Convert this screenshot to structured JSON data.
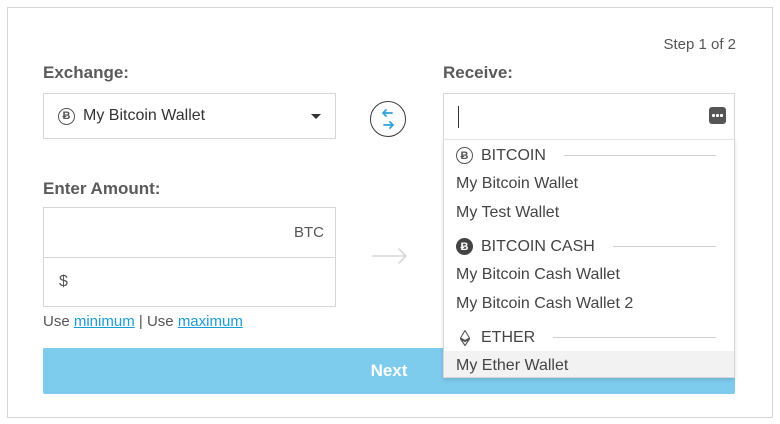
{
  "step_indicator": "Step 1 of 2",
  "exchange": {
    "label": "Exchange:",
    "selected_coin_glyph": "Ƀ",
    "selected_wallet": "My Bitcoin Wallet"
  },
  "receive": {
    "label": "Receive:",
    "input_value": "",
    "groups": [
      {
        "name": "BITCOIN",
        "glyph": "Ƀ",
        "icon": "bitcoin-outline-icon",
        "wallets": [
          "My Bitcoin Wallet",
          "My Test Wallet"
        ]
      },
      {
        "name": "BITCOIN CASH",
        "glyph": "Ƀ",
        "icon": "bitcoin-cash-filled-icon",
        "wallets": [
          "My Bitcoin Cash Wallet",
          "My Bitcoin Cash Wallet 2"
        ]
      },
      {
        "name": "ETHER",
        "glyph": "◊",
        "icon": "ether-icon",
        "wallets": [
          "My Ether Wallet"
        ]
      }
    ]
  },
  "amount": {
    "label": "Enter Amount:",
    "crypto_value": "",
    "crypto_unit": "BTC",
    "fiat_value": "",
    "fiat_symbol": "$"
  },
  "limits": {
    "use_prefix_1": "Use",
    "minimum_link": "minimum",
    "separator": "|",
    "use_prefix_2": "Use",
    "maximum_link": "maximum"
  },
  "next_button": "Next",
  "colors": {
    "accent_blue": "#1a9cd8",
    "button_blue": "#7dcbed",
    "swap_arrow_blue": "#2ba3dc",
    "border": "#d6d6d6"
  }
}
